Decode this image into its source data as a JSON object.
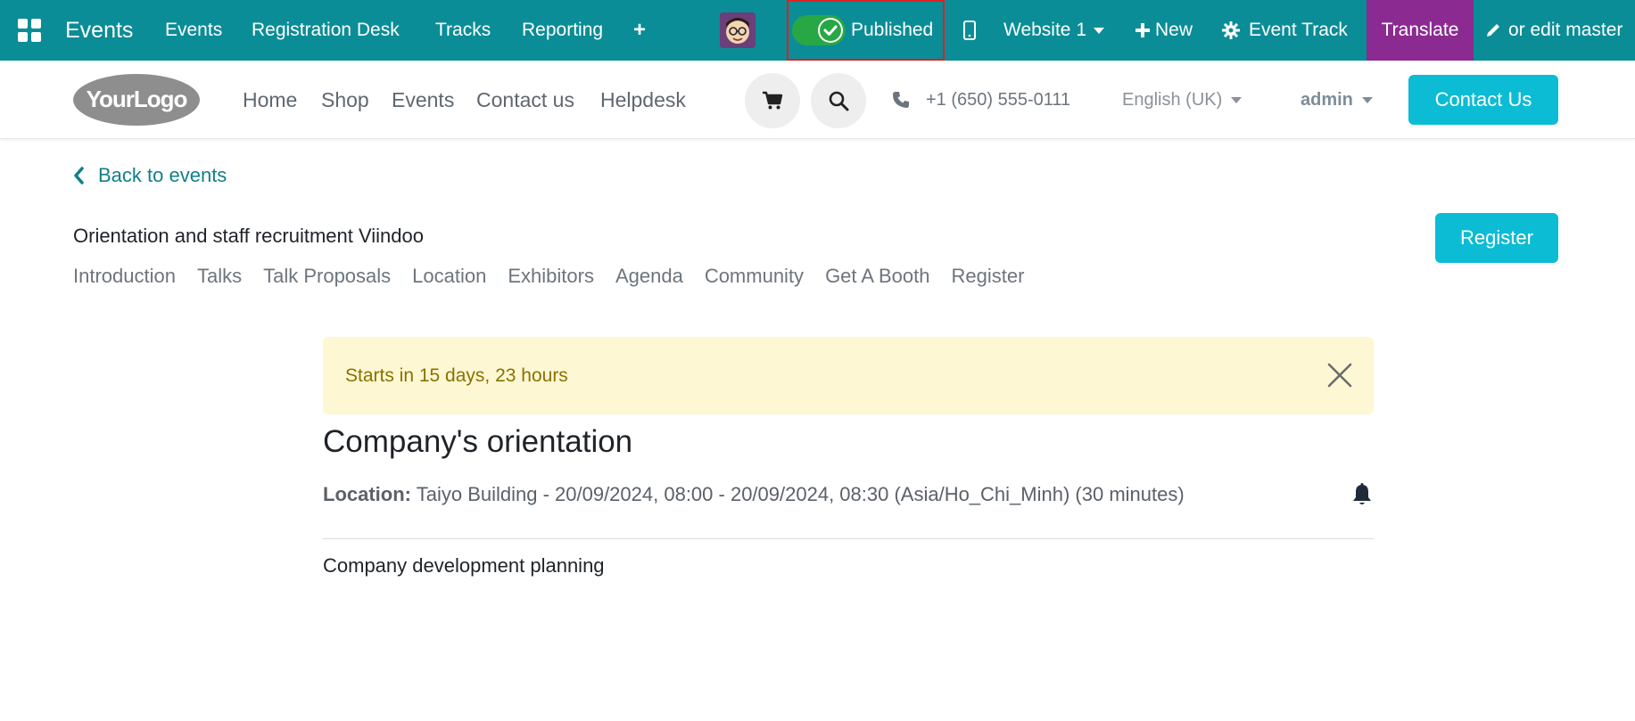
{
  "topbar": {
    "app_title": "Events",
    "menu": [
      "Events",
      "Registration Desk",
      "Tracks",
      "Reporting"
    ],
    "plus": "+",
    "published_label": "Published",
    "website_label": "Website 1",
    "new_label": "New",
    "event_track_label": "Event Track",
    "translate_label": "Translate",
    "edit_master_label": "or edit master",
    "colors": {
      "bar": "#0a8d97",
      "translate": "#8b2b92",
      "toggle_on": "#28a745",
      "highlight_box": "#e02020"
    }
  },
  "header": {
    "logo_text": "YourLogo",
    "nav": [
      "Home",
      "Shop",
      "Events",
      "Contact us",
      "Helpdesk"
    ],
    "phone": "+1 (650) 555-0111",
    "language": "English (UK)",
    "user": "admin",
    "contact_button": "Contact Us",
    "colors": {
      "accent": "#0bbcd4"
    }
  },
  "event": {
    "back_label": "Back to events",
    "name": "Orientation and staff recruitment Viindoo",
    "register_button": "Register",
    "tabs": [
      "Introduction",
      "Talks",
      "Talk Proposals",
      "Location",
      "Exhibitors",
      "Agenda",
      "Community",
      "Get A Booth",
      "Register"
    ]
  },
  "talk": {
    "countdown": "Starts in 15 days, 23 hours",
    "title": "Company's orientation",
    "location_label": "Location:",
    "location_value": "Taiyo Building - 20/09/2024, 08:00 - 20/09/2024, 08:30 (Asia/Ho_Chi_Minh) (30 minutes)",
    "description": "Company development planning"
  }
}
